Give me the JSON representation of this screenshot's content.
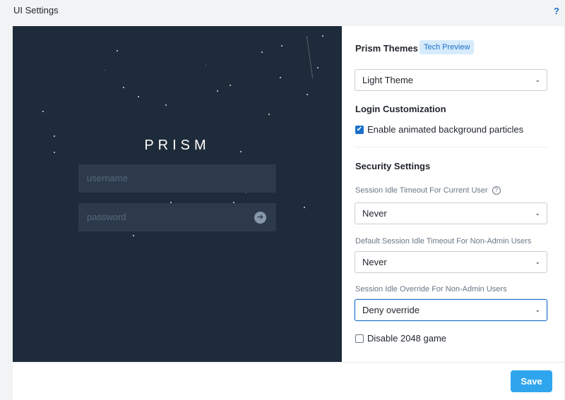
{
  "header": {
    "title": "UI Settings",
    "help": "?"
  },
  "preview": {
    "brand": "PRISM",
    "username_placeholder": "username",
    "password_placeholder": "password",
    "submit_icon": "arrow-right-circle-icon"
  },
  "themes": {
    "title": "Prism Themes",
    "badge": "Tech Preview",
    "selected": "Light Theme"
  },
  "login": {
    "title": "Login Customization",
    "particles_label": "Enable animated background particles",
    "particles_checked": true
  },
  "security": {
    "title": "Security Settings",
    "current_user_label": "Session Idle Timeout For Current User",
    "current_user_value": "Never",
    "non_admin_label": "Default Session Idle Timeout For Non-Admin Users",
    "non_admin_value": "Never",
    "override_label": "Session Idle Override For Non-Admin Users",
    "override_value": "Deny override"
  },
  "game": {
    "label": "Disable 2048 game",
    "checked": false
  },
  "footer": {
    "save_label": "Save"
  },
  "colors": {
    "accent": "#1b6fc9",
    "preview_bg": "#1e2b3a",
    "save_bg": "#2fa5ee"
  }
}
